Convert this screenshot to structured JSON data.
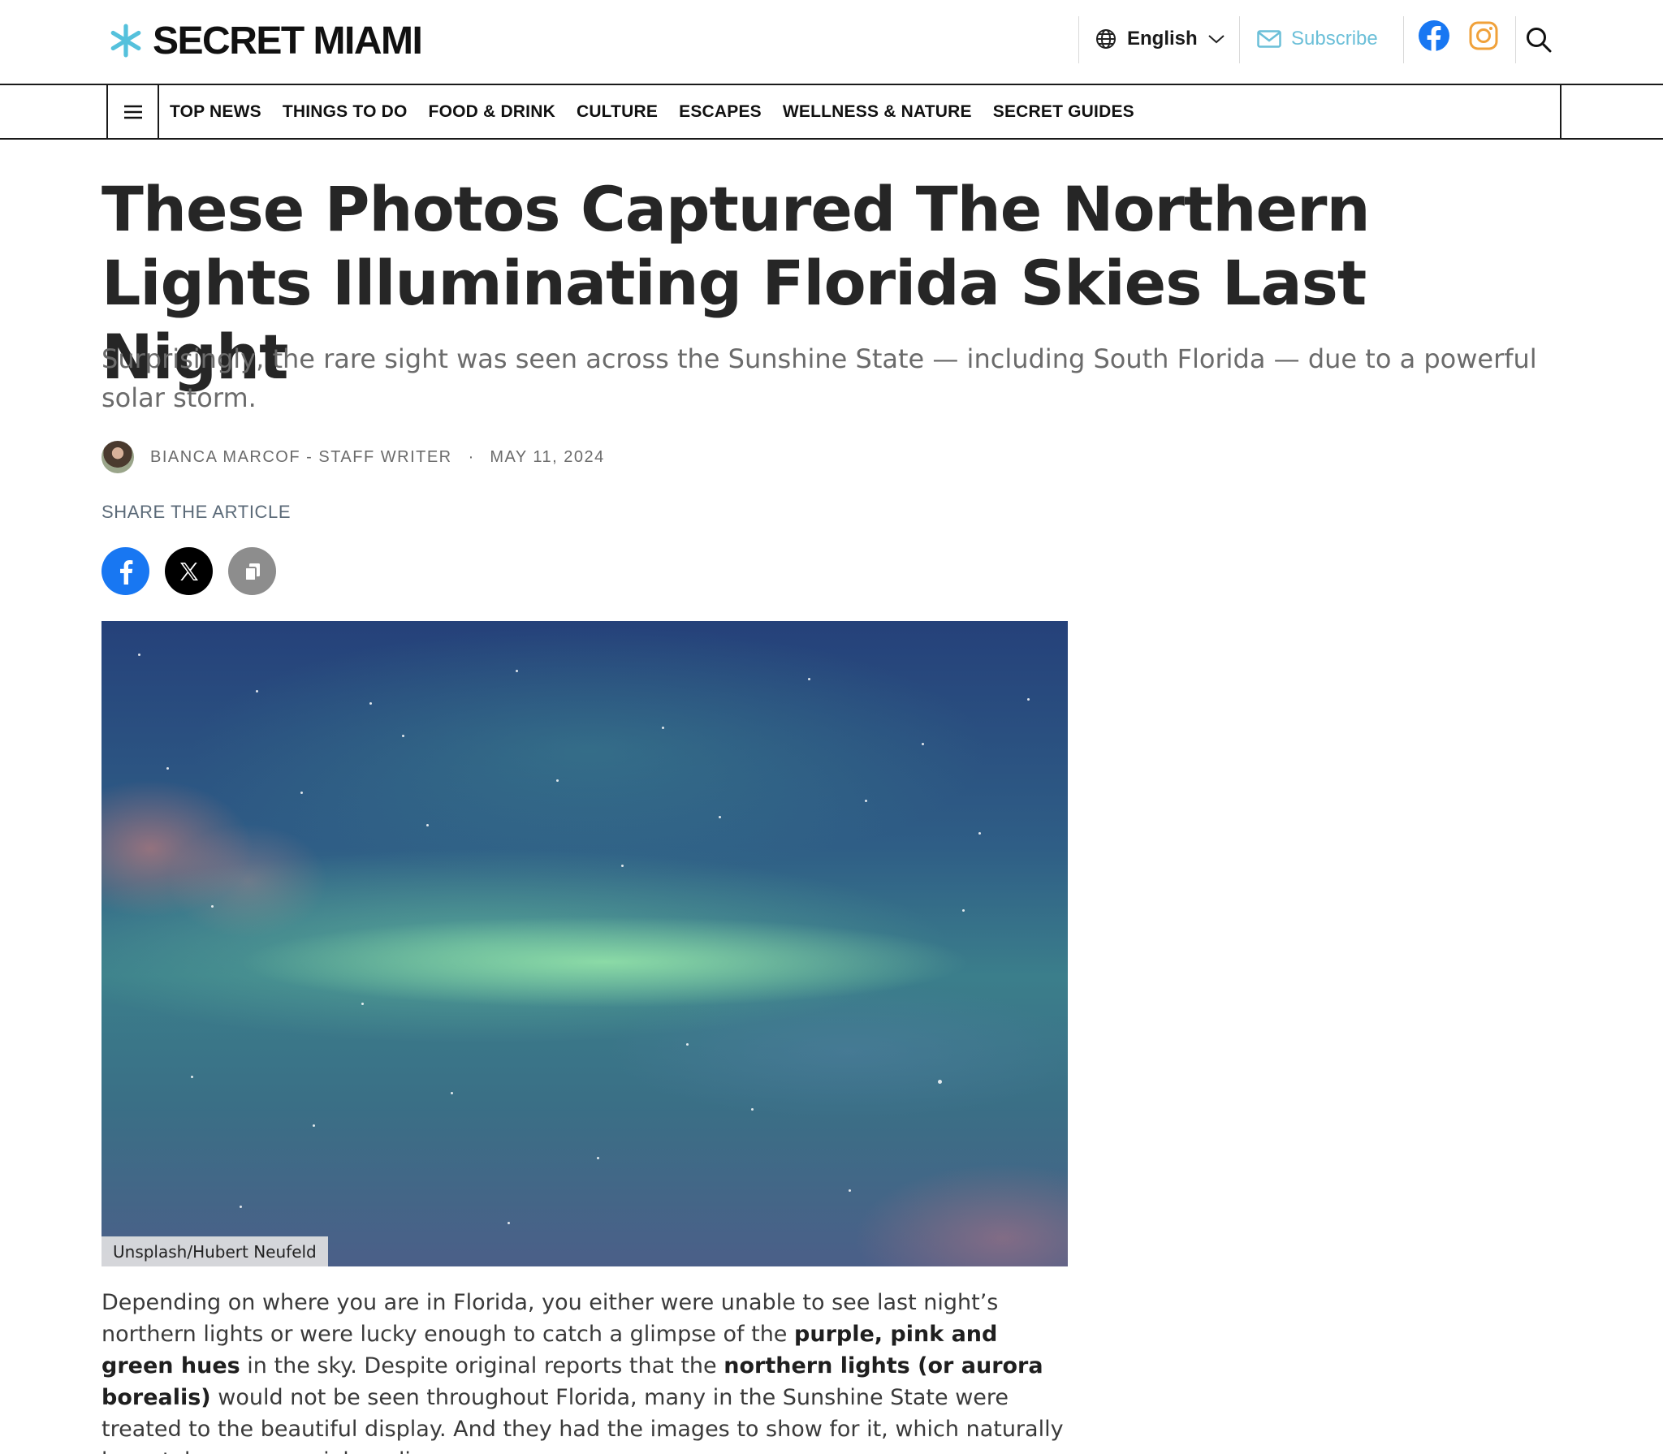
{
  "header": {
    "logo_text": "SECRET MIAMI",
    "language_label": "English",
    "subscribe_label": "Subscribe",
    "colors": {
      "accent": "#6bbfd8",
      "facebook": "#1877f2",
      "instagram": "#f0a13a"
    },
    "icons": [
      "globe-icon",
      "chevron-down-icon",
      "mail-icon",
      "facebook-icon",
      "instagram-icon",
      "search-icon"
    ]
  },
  "nav": {
    "items": [
      "TOP NEWS",
      "THINGS TO DO",
      "FOOD & DRINK",
      "CULTURE",
      "ESCAPES",
      "WELLNESS & NATURE",
      "SECRET GUIDES"
    ]
  },
  "article": {
    "title": "These Photos Captured The Northern Lights Illuminating Florida Skies Last Night",
    "subtitle": "Surprisingly, the rare sight was seen across the Sunshine State — including South Florida — due to a powerful solar storm.",
    "author": "BIANCA MARCOF - STAFF WRITER",
    "separator": "·",
    "date": "MAY 11, 2024",
    "share_label": "SHARE THE ARTICLE",
    "image_caption": "Unsplash/Hubert Neufeld",
    "body": {
      "p1_a": "Depending on where you are in Florida, you either were unable to see last night’s northern lights or were lucky enough to catch a glimpse of the ",
      "p1_bold1": "purple, pink and green hues",
      "p1_b": " in the sky. Despite original reports that the ",
      "p1_bold2": "northern lights (or aurora borealis)",
      "p1_c": " would not be seen throughout Florida, many in the Sunshine State were treated to the beautiful display. And they had the images to show for it, which naturally have taken over social media."
    }
  }
}
